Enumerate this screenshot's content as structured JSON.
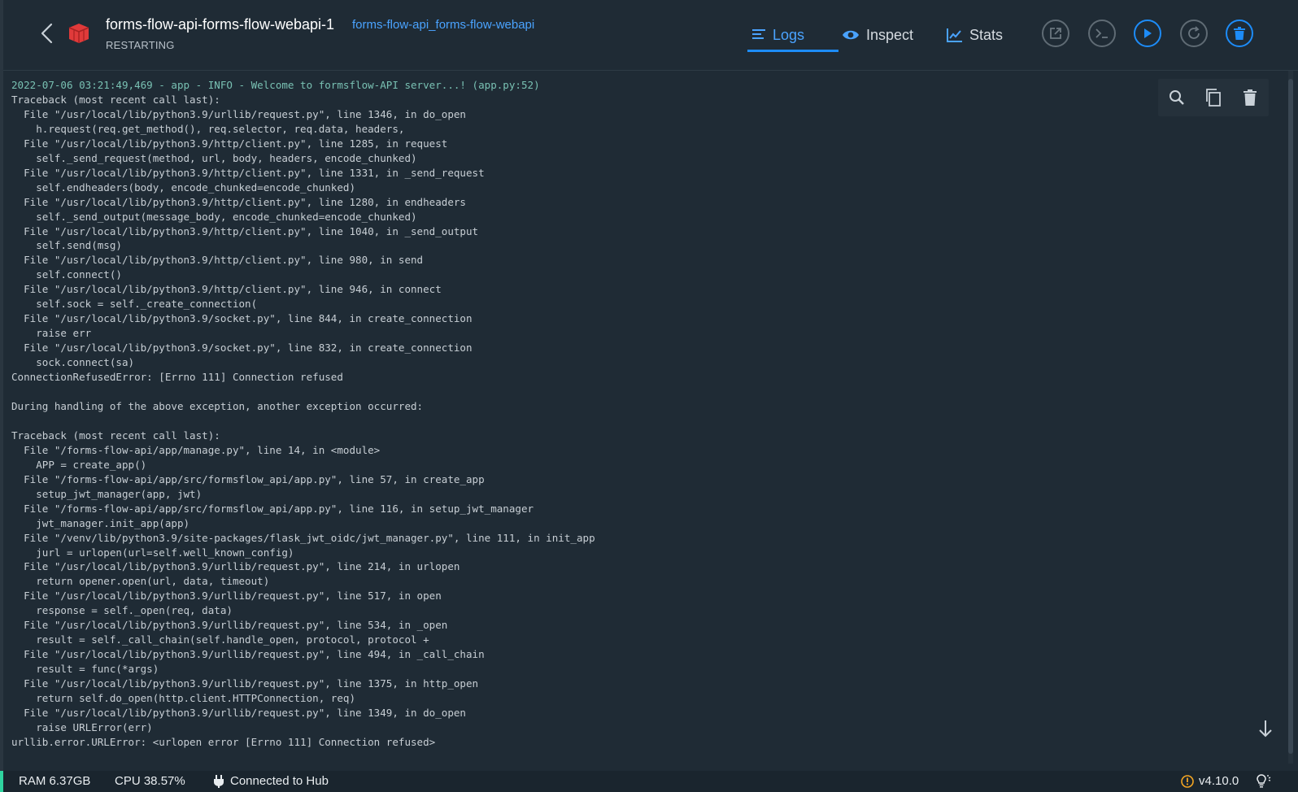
{
  "header": {
    "container_name": "forms-flow-api-forms-flow-webapi-1",
    "container_link": "forms-flow-api_forms-flow-webapi",
    "status": "RESTARTING",
    "tabs": [
      {
        "label": "Logs",
        "icon": "list-icon",
        "active": true
      },
      {
        "label": "Inspect",
        "icon": "eye-icon",
        "active": false
      },
      {
        "label": "Stats",
        "icon": "chart-icon",
        "active": false
      }
    ],
    "actions": [
      "open-browser-icon",
      "cli-icon",
      "start-icon",
      "restart-icon",
      "delete-icon"
    ]
  },
  "colors": {
    "background": "#1f2b35",
    "accent": "#1d8cf8",
    "link": "#4aa3ff",
    "container_icon": "#e03a3a",
    "status_ok": "#2fd4a0",
    "warning": "#f5a623"
  },
  "logs": {
    "first_line": "2022-07-06 03:21:49,469 - app - INFO - Welcome to formsflow-API server...! (app.py:52)",
    "lines": [
      "Traceback (most recent call last):",
      "  File \"/usr/local/lib/python3.9/urllib/request.py\", line 1346, in do_open",
      "    h.request(req.get_method(), req.selector, req.data, headers,",
      "  File \"/usr/local/lib/python3.9/http/client.py\", line 1285, in request",
      "    self._send_request(method, url, body, headers, encode_chunked)",
      "  File \"/usr/local/lib/python3.9/http/client.py\", line 1331, in _send_request",
      "    self.endheaders(body, encode_chunked=encode_chunked)",
      "  File \"/usr/local/lib/python3.9/http/client.py\", line 1280, in endheaders",
      "    self._send_output(message_body, encode_chunked=encode_chunked)",
      "  File \"/usr/local/lib/python3.9/http/client.py\", line 1040, in _send_output",
      "    self.send(msg)",
      "  File \"/usr/local/lib/python3.9/http/client.py\", line 980, in send",
      "    self.connect()",
      "  File \"/usr/local/lib/python3.9/http/client.py\", line 946, in connect",
      "    self.sock = self._create_connection(",
      "  File \"/usr/local/lib/python3.9/socket.py\", line 844, in create_connection",
      "    raise err",
      "  File \"/usr/local/lib/python3.9/socket.py\", line 832, in create_connection",
      "    sock.connect(sa)",
      "ConnectionRefusedError: [Errno 111] Connection refused",
      "",
      "During handling of the above exception, another exception occurred:",
      "",
      "Traceback (most recent call last):",
      "  File \"/forms-flow-api/app/manage.py\", line 14, in <module>",
      "    APP = create_app()",
      "  File \"/forms-flow-api/app/src/formsflow_api/app.py\", line 57, in create_app",
      "    setup_jwt_manager(app, jwt)",
      "  File \"/forms-flow-api/app/src/formsflow_api/app.py\", line 116, in setup_jwt_manager",
      "    jwt_manager.init_app(app)",
      "  File \"/venv/lib/python3.9/site-packages/flask_jwt_oidc/jwt_manager.py\", line 111, in init_app",
      "    jurl = urlopen(url=self.well_known_config)",
      "  File \"/usr/local/lib/python3.9/urllib/request.py\", line 214, in urlopen",
      "    return opener.open(url, data, timeout)",
      "  File \"/usr/local/lib/python3.9/urllib/request.py\", line 517, in open",
      "    response = self._open(req, data)",
      "  File \"/usr/local/lib/python3.9/urllib/request.py\", line 534, in _open",
      "    result = self._call_chain(self.handle_open, protocol, protocol +",
      "  File \"/usr/local/lib/python3.9/urllib/request.py\", line 494, in _call_chain",
      "    result = func(*args)",
      "  File \"/usr/local/lib/python3.9/urllib/request.py\", line 1375, in http_open",
      "    return self.do_open(http.client.HTTPConnection, req)",
      "  File \"/usr/local/lib/python3.9/urllib/request.py\", line 1349, in do_open",
      "    raise URLError(err)",
      "urllib.error.URLError: <urlopen error [Errno 111] Connection refused>"
    ],
    "tools": [
      "search-icon",
      "copy-icon",
      "trash-icon"
    ]
  },
  "footer": {
    "ram": "RAM 6.37GB",
    "cpu": "CPU 38.57%",
    "hub": "Connected to Hub",
    "version": "v4.10.0"
  }
}
